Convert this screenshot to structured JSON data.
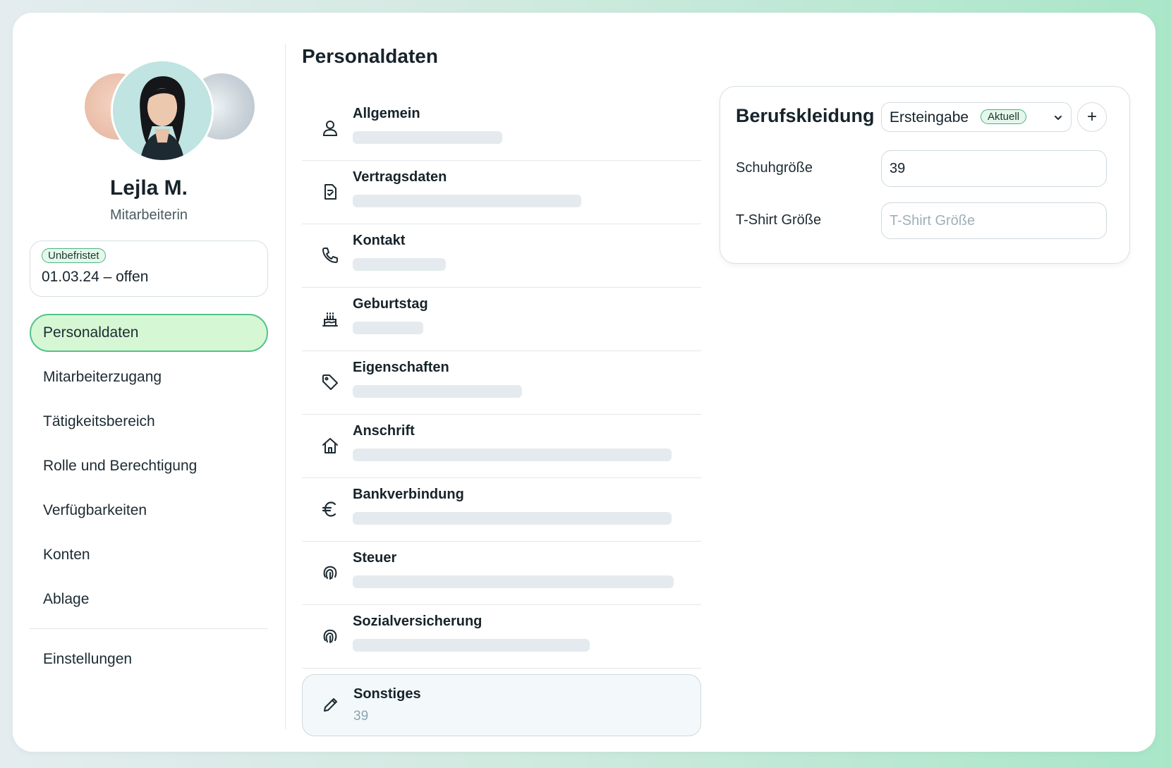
{
  "profile": {
    "name": "Lejla M.",
    "role": "Mitarbeiterin",
    "contract_badge": "Unbefristet",
    "contract_dates": "01.03.24 – offen"
  },
  "sidebar": {
    "items": [
      {
        "label": "Personaldaten",
        "active": true
      },
      {
        "label": "Mitarbeiterzugang"
      },
      {
        "label": "Tätigkeitsbereich"
      },
      {
        "label": "Rolle und Berechtigung"
      },
      {
        "label": "Verfügbarkeiten"
      },
      {
        "label": "Konten"
      },
      {
        "label": "Ablage"
      }
    ],
    "settings_label": "Einstellungen"
  },
  "main": {
    "title": "Personaldaten",
    "sections": [
      {
        "label": "Allgemein",
        "icon": "user-icon"
      },
      {
        "label": "Vertragsdaten",
        "icon": "contract-icon"
      },
      {
        "label": "Kontakt",
        "icon": "phone-icon"
      },
      {
        "label": "Geburtstag",
        "icon": "cake-icon"
      },
      {
        "label": "Eigenschaften",
        "icon": "tag-icon"
      },
      {
        "label": "Anschrift",
        "icon": "home-icon"
      },
      {
        "label": "Bankverbindung",
        "icon": "euro-icon"
      },
      {
        "label": "Steuer",
        "icon": "fingerprint-icon"
      },
      {
        "label": "Sozialversicherung",
        "icon": "fingerprint-icon"
      },
      {
        "label": "Sonstiges",
        "icon": "pencil-icon",
        "value": "39"
      }
    ]
  },
  "workwear": {
    "title": "Berufskleidung",
    "dropdown_value": "Ersteingabe",
    "dropdown_badge": "Aktuell",
    "add_label": "+",
    "shoe_label": "Schuhgröße",
    "shoe_value": "39",
    "tshirt_label": "T-Shirt Größe",
    "tshirt_placeholder": "T-Shirt Größe"
  },
  "colors": {
    "accent_green": "#52c28d",
    "active_bg": "#d6f7d3",
    "skeleton": "#e4eaee"
  }
}
